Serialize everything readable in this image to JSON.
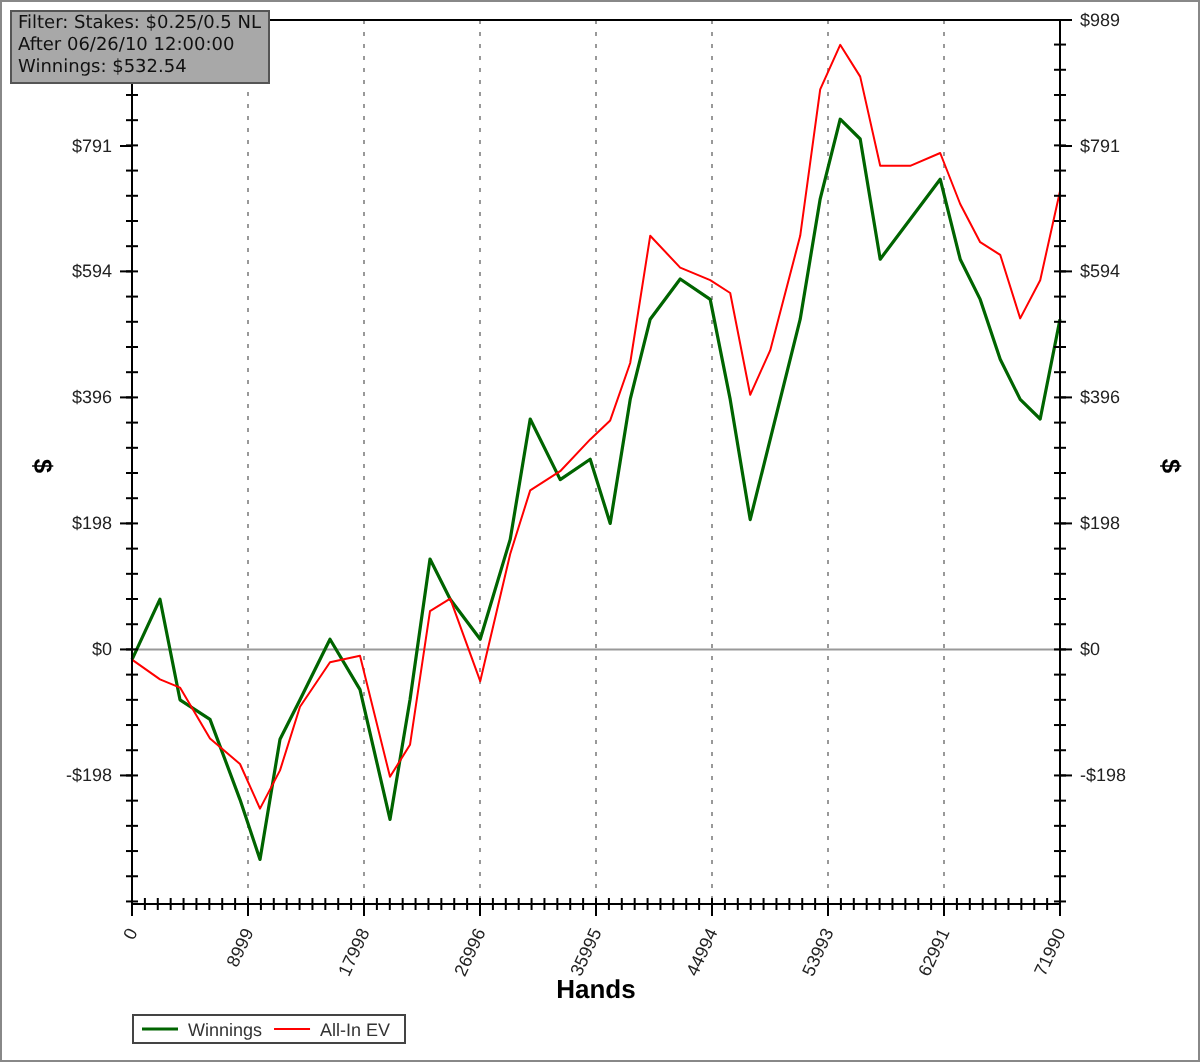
{
  "info_box": {
    "lines": [
      "Filter: Stakes: $0.25/0.5 NL",
      "After 06/26/10 12:00:00",
      "Winnings: $532.54"
    ]
  },
  "chart": {
    "right_ylabel": "$",
    "left_ytick_labels": [
      "$791",
      "$594",
      "$396",
      "$198",
      "$0",
      "-$198"
    ],
    "chart_data": {
      "type": "line",
      "xlabel": "Hands",
      "ylabel": "$",
      "xlim": [
        0,
        71990
      ],
      "ylim": [
        -400,
        989
      ],
      "xticks": [
        0,
        8999,
        17998,
        26996,
        35995,
        44994,
        53993,
        62991,
        71990
      ],
      "yticks": [
        {
          "value": 989,
          "label": "$989"
        },
        {
          "value": 791,
          "label": "$791"
        },
        {
          "value": 594,
          "label": "$594"
        },
        {
          "value": 396,
          "label": "$396"
        },
        {
          "value": 198,
          "label": "$198"
        },
        {
          "value": 0,
          "label": "$0"
        },
        {
          "value": -198,
          "label": "-$198"
        }
      ],
      "grid": {
        "x": true,
        "zero_line": true
      },
      "legend": true,
      "x": [
        0,
        2173,
        3725,
        6053,
        8382,
        9933,
        11485,
        13037,
        15365,
        17693,
        20021,
        21573,
        23125,
        24677,
        27005,
        29333,
        30885,
        33213,
        35541,
        37093,
        38645,
        40197,
        42525,
        44853,
        46405,
        47957,
        49509,
        51837,
        53389,
        54941,
        56493,
        58045,
        60373,
        62701,
        64253,
        65805,
        67357,
        68909,
        70461,
        71990
      ],
      "series": [
        {
          "name": "Winnings",
          "color": "#006400",
          "values": [
            -16,
            79,
            -79,
            -110,
            -236,
            -330,
            -141,
            -79,
            16,
            -63,
            -267,
            -79,
            142,
            79,
            16,
            173,
            362,
            267,
            299,
            198,
            393,
            519,
            582,
            550,
            393,
            204,
            330,
            519,
            708,
            833,
            802,
            613,
            676,
            739,
            613,
            550,
            456,
            393,
            362,
            519
          ]
        },
        {
          "name": "All-In EV",
          "color": "#ff0000",
          "values": [
            -16,
            -47,
            -60,
            -140,
            -180,
            -250,
            -190,
            -90,
            -20,
            -10,
            -200,
            -150,
            60,
            80,
            -50,
            150,
            250,
            280,
            330,
            360,
            450,
            650,
            600,
            580,
            560,
            400,
            470,
            650,
            880,
            950,
            900,
            760,
            760,
            780,
            700,
            640,
            620,
            520,
            580,
            720
          ]
        }
      ]
    }
  }
}
